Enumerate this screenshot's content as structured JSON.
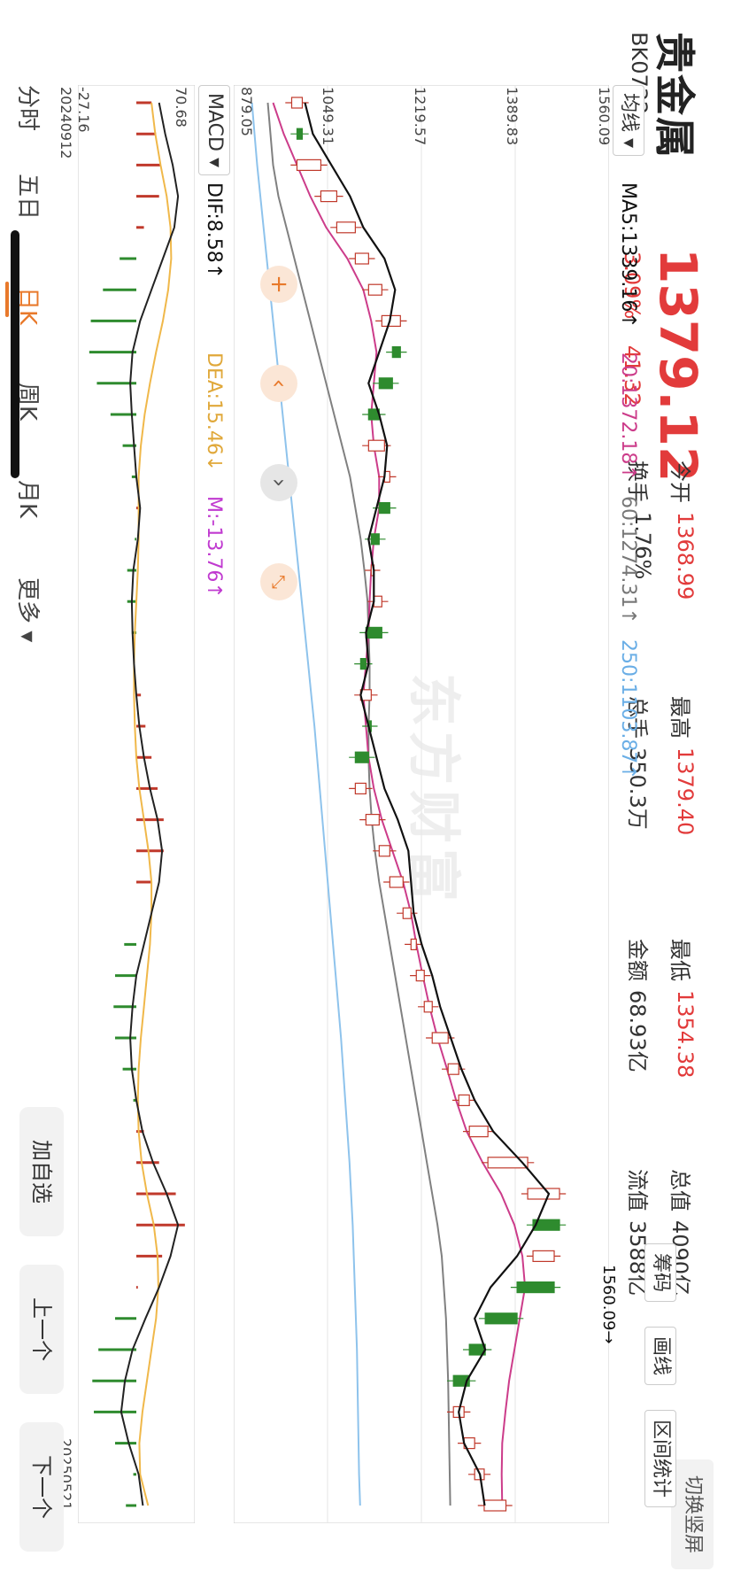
{
  "header": {
    "title": "贵金属",
    "code": "BK0732",
    "price": "1379.12",
    "change_pct": "3.09%",
    "change_val": "41.32",
    "switch_label": "切换竖屏"
  },
  "quote": [
    {
      "label": "今开",
      "value": "1368.99",
      "color": "red"
    },
    {
      "label": "换手",
      "value": "1.76%",
      "color": "dark"
    },
    {
      "label": "最高",
      "value": "1379.40",
      "color": "red"
    },
    {
      "label": "总手",
      "value": "350.3万",
      "color": "dark"
    },
    {
      "label": "最低",
      "value": "1354.38",
      "color": "red"
    },
    {
      "label": "金额",
      "value": "68.93亿",
      "color": "dark"
    },
    {
      "label": "总值",
      "value": "4090亿",
      "color": "dark"
    },
    {
      "label": "流值",
      "value": "3588亿",
      "color": "dark"
    }
  ],
  "toolbar": {
    "chips": "筹码",
    "draw": "画线",
    "range_stats": "区间统计"
  },
  "ma_selector": "均线",
  "ma_labels": {
    "ma5": "MA5:1339.16↑",
    "ma20": "20:1372.18↑",
    "ma60": "60:1274.31↑",
    "ma250": "250:1103.87↑"
  },
  "macd_selector": "MACD",
  "macd_labels": {
    "dif": "DIF:8.58↑",
    "dea": "DEA:15.46↓",
    "m": "M:-13.76↑"
  },
  "main_axis": [
    "1560.09",
    "1389.83",
    "1219.57",
    "1049.31",
    "879.05"
  ],
  "macd_axis": {
    "top": "70.68",
    "bottom": "-27.16"
  },
  "dates": {
    "start": "20240912",
    "end": "20250521"
  },
  "annotations": {
    "max_label": "1560.09→"
  },
  "tabs": [
    "分时",
    "五日",
    "日K",
    "周K",
    "月K",
    "更多"
  ],
  "active_tab": "日K",
  "buttons": {
    "add_watch": "加自选",
    "prev": "上一个",
    "next": "下一个"
  },
  "watermark": "东方财富",
  "colors": {
    "up": "#c0392b",
    "down": "#2e8b2e",
    "ma5": "#111111",
    "ma20": "#cc3c8a",
    "ma60": "#808080",
    "ma250": "#8ec3ec",
    "dea": "#f0b84a",
    "accent": "#e8792b"
  },
  "chart_data": [
    {
      "type": "candlestick",
      "title": "",
      "ylim": [
        879.05,
        1560.09
      ],
      "x_range": [
        "20240912",
        "20250521"
      ],
      "ma5": [
        1000,
        1015,
        1050,
        1085,
        1110,
        1150,
        1170,
        1160,
        1140,
        1120,
        1140,
        1155,
        1150,
        1135,
        1120,
        1130,
        1130,
        1115,
        1120,
        1105,
        1120,
        1135,
        1150,
        1175,
        1195,
        1200,
        1205,
        1220,
        1240,
        1255,
        1275,
        1295,
        1320,
        1355,
        1410,
        1460,
        1435,
        1400,
        1350,
        1320,
        1340,
        1305,
        1290,
        1300,
        1330,
        1339
      ],
      "ma20": [
        940,
        960,
        985,
        1010,
        1040,
        1080,
        1110,
        1125,
        1135,
        1130,
        1125,
        1130,
        1140,
        1140,
        1130,
        1125,
        1122,
        1120,
        1115,
        1110,
        1115,
        1120,
        1130,
        1145,
        1165,
        1185,
        1200,
        1210,
        1222,
        1235,
        1250,
        1268,
        1285,
        1305,
        1335,
        1370,
        1395,
        1410,
        1415,
        1405,
        1395,
        1385,
        1378,
        1372,
        1371,
        1372
      ],
      "ma60": [
        930,
        935,
        940,
        950,
        965,
        980,
        995,
        1010,
        1025,
        1040,
        1055,
        1070,
        1085,
        1095,
        1105,
        1112,
        1118,
        1120,
        1122,
        1122,
        1120,
        1120,
        1122,
        1126,
        1132,
        1140,
        1150,
        1160,
        1170,
        1180,
        1190,
        1200,
        1210,
        1220,
        1230,
        1240,
        1250,
        1258,
        1262,
        1266,
        1268,
        1270,
        1271,
        1272,
        1273,
        1274
      ],
      "ma250": [
        900,
        905,
        910,
        916,
        922,
        928,
        934,
        940,
        946,
        952,
        958,
        964,
        970,
        976,
        982,
        988,
        994,
        1000,
        1006,
        1012,
        1018,
        1023,
        1028,
        1033,
        1038,
        1043,
        1048,
        1053,
        1058,
        1063,
        1068,
        1072,
        1076,
        1080,
        1084,
        1087,
        1090,
        1092,
        1094,
        1096,
        1098,
        1099,
        1100,
        1101,
        1102,
        1104
      ],
      "candles": [
        {
          "o": 975,
          "c": 995
        },
        {
          "o": 995,
          "c": 985
        },
        {
          "o": 985,
          "c": 1030
        },
        {
          "o": 1030,
          "c": 1060
        },
        {
          "o": 1060,
          "c": 1095
        },
        {
          "o": 1095,
          "c": 1120
        },
        {
          "o": 1120,
          "c": 1145
        },
        {
          "o": 1145,
          "c": 1180
        },
        {
          "o": 1180,
          "c": 1165
        },
        {
          "o": 1165,
          "c": 1140
        },
        {
          "o": 1140,
          "c": 1120
        },
        {
          "o": 1120,
          "c": 1150
        },
        {
          "o": 1150,
          "c": 1160
        },
        {
          "o": 1160,
          "c": 1140
        },
        {
          "o": 1140,
          "c": 1125
        },
        {
          "o": 1125,
          "c": 1130
        },
        {
          "o": 1130,
          "c": 1145
        },
        {
          "o": 1145,
          "c": 1115
        },
        {
          "o": 1115,
          "c": 1105
        },
        {
          "o": 1105,
          "c": 1125
        },
        {
          "o": 1125,
          "c": 1120
        },
        {
          "o": 1120,
          "c": 1095
        },
        {
          "o": 1095,
          "c": 1115
        },
        {
          "o": 1115,
          "c": 1140
        },
        {
          "o": 1140,
          "c": 1160
        },
        {
          "o": 1160,
          "c": 1185
        },
        {
          "o": 1185,
          "c": 1200
        },
        {
          "o": 1200,
          "c": 1210
        },
        {
          "o": 1210,
          "c": 1225
        },
        {
          "o": 1225,
          "c": 1240
        },
        {
          "o": 1240,
          "c": 1270
        },
        {
          "o": 1270,
          "c": 1290
        },
        {
          "o": 1290,
          "c": 1310
        },
        {
          "o": 1310,
          "c": 1345
        },
        {
          "o": 1345,
          "c": 1420
        },
        {
          "o": 1420,
          "c": 1480
        },
        {
          "o": 1480,
          "c": 1430
        },
        {
          "o": 1430,
          "c": 1470
        },
        {
          "o": 1470,
          "c": 1400
        },
        {
          "o": 1400,
          "c": 1340
        },
        {
          "o": 1340,
          "c": 1310
        },
        {
          "o": 1310,
          "c": 1280
        },
        {
          "o": 1280,
          "c": 1300
        },
        {
          "o": 1300,
          "c": 1320
        },
        {
          "o": 1320,
          "c": 1338
        },
        {
          "o": 1338,
          "c": 1379
        }
      ]
    },
    {
      "type": "bar",
      "title": "MACD",
      "ylim": [
        -27.16,
        70.68
      ],
      "dif": [
        30,
        38,
        48,
        55,
        50,
        35,
        20,
        5,
        -5,
        -8,
        -6,
        -3,
        0,
        5,
        2,
        -4,
        -6,
        -5,
        -3,
        0,
        4,
        10,
        18,
        28,
        34,
        30,
        20,
        10,
        0,
        -5,
        -8,
        -6,
        0,
        8,
        22,
        40,
        55,
        45,
        30,
        12,
        -5,
        -15,
        -20,
        -10,
        3,
        8.58
      ],
      "dea": [
        20,
        25,
        32,
        40,
        45,
        46,
        42,
        35,
        26,
        18,
        11,
        6,
        3,
        3,
        3,
        2,
        0,
        -2,
        -3,
        -3,
        -2,
        0,
        4,
        10,
        16,
        20,
        20,
        18,
        14,
        10,
        6,
        3,
        2,
        3,
        7,
        14,
        23,
        28,
        29,
        26,
        20,
        14,
        8,
        4,
        5,
        15.46
      ],
      "m": [
        20,
        26,
        32,
        30,
        10,
        -22,
        -44,
        -60,
        -62,
        -52,
        -34,
        -18,
        -6,
        4,
        -2,
        -12,
        -12,
        -6,
        0,
        6,
        12,
        20,
        28,
        36,
        36,
        20,
        0,
        -16,
        -28,
        -30,
        -28,
        -18,
        -4,
        10,
        30,
        52,
        64,
        34,
        2,
        -28,
        -50,
        -58,
        -56,
        -28,
        -4,
        -13.76
      ]
    }
  ]
}
